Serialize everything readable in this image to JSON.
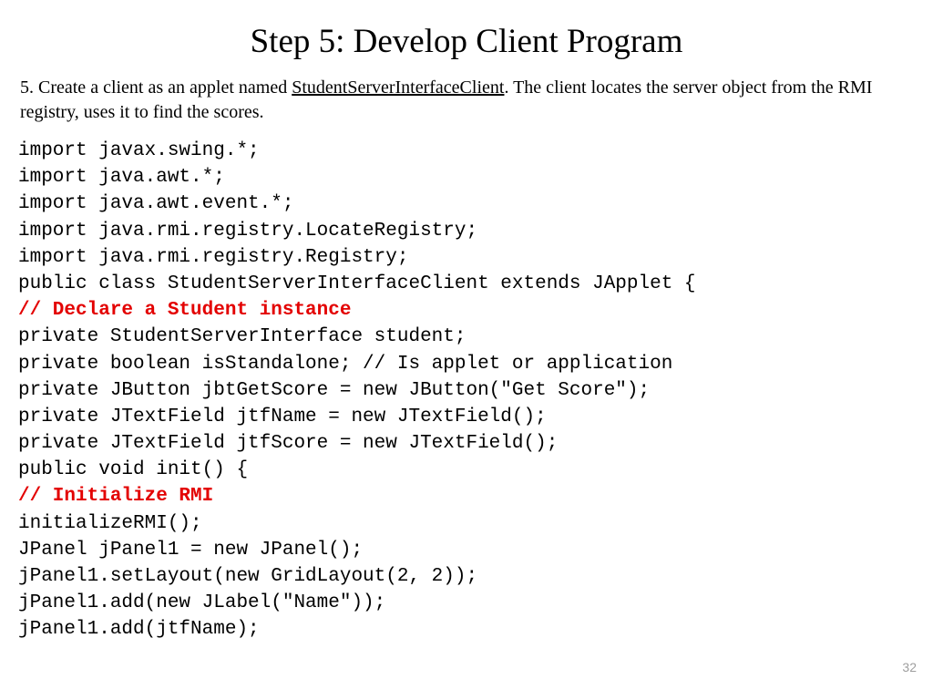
{
  "title": "Step 5: Develop Client Program",
  "instruction": {
    "prefix": "5.  Create a client as an applet named ",
    "link": "StudentServerInterfaceClient",
    "suffix": ". The client locates the server object from the RMI registry, uses it to find the scores."
  },
  "code": {
    "l1": "import javax.swing.*;",
    "l2": "import java.awt.*;",
    "l3": "import java.awt.event.*;",
    "l4": "import java.rmi.registry.LocateRegistry;",
    "l5": "import java.rmi.registry.Registry;",
    "l6": "public class StudentServerInterfaceClient extends JApplet {",
    "l7": "// Declare a Student instance",
    "l8": "private StudentServerInterface student;",
    "l9": "private boolean isStandalone; // Is applet or application",
    "l10": "private JButton jbtGetScore = new JButton(\"Get Score\");",
    "l11": "private JTextField jtfName = new JTextField();",
    "l12": "private JTextField jtfScore = new JTextField();",
    "l13": "public void init() {",
    "l14": "// Initialize RMI",
    "l15": "initializeRMI();",
    "l16": "JPanel jPanel1 = new JPanel();",
    "l17": "jPanel1.setLayout(new GridLayout(2, 2));",
    "l18": "jPanel1.add(new JLabel(\"Name\"));",
    "l19": "jPanel1.add(jtfName);"
  },
  "pageNumber": "32"
}
